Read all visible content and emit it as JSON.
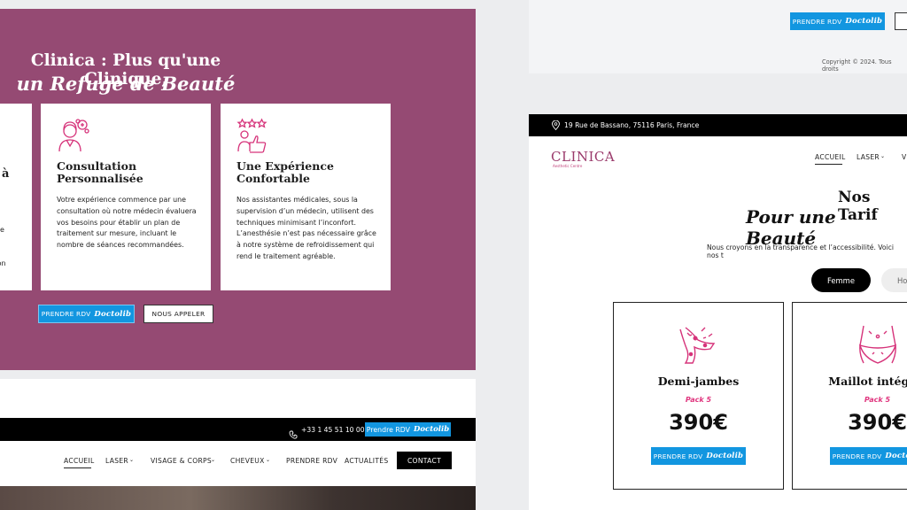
{
  "colors": {
    "purple": "#954a73",
    "blue": "#1296e0",
    "pink": "#e0357e",
    "black": "#000000"
  },
  "hero": {
    "line1": "Clinica : Plus qu'une Clinique,",
    "line2": "un Refuge de Beauté"
  },
  "partial_card": {
    "title_fragment": "à",
    "text_fragments": [
      "e",
      "ision"
    ]
  },
  "cards": [
    {
      "icon": "doctor-consultation-icon",
      "title_line1": "Consultation",
      "title_line2": "Personnalisée",
      "text": "Votre expérience commence par une consultation où notre médecin évaluera vos besoins pour établir un plan de traitement sur mesure, incluant le nombre de séances recommandées."
    },
    {
      "icon": "thumbs-up-stars-icon",
      "title_line1": "Une Expérience",
      "title_line2": "Confortable",
      "text": "Nos assistantes médicales, sous la supervision d’un médecin, utilisent des techniques minimisant l’inconfort. L’anesthésie n’est pas nécessaire grâce à notre système de refroidissement qui rend le traitement agréable."
    }
  ],
  "cta": {
    "rdv_label": "PRENDRE RDV",
    "doctolib": "Doctolib",
    "call_label": "NOUS APPELER"
  },
  "left_header": {
    "phone": "+33 1 45 51 10 00",
    "rdv_label": "Prendre RDV",
    "doctolib": "Doctolib",
    "nav": {
      "accueil": "ACCUEIL",
      "laser": "LASER",
      "visage": "VISAGE & CORPS",
      "cheveux": "CHEVEUX",
      "rdv": "PRENDRE RDV",
      "actualites": "ACTUALITÉS",
      "contact": "CONTACT"
    }
  },
  "right_top": {
    "rdv_label": "PRENDRE RDV",
    "doctolib": "Doctolib",
    "copyright": "Copyright © 2024. Tous droits"
  },
  "right_header": {
    "address": "19 Rue de Bassano, 75116 Paris, France",
    "logo": "CLINICA",
    "logo_sub": "Aesthetic Centre",
    "nav": {
      "accueil": "ACCUEIL",
      "laser": "LASER",
      "partial": "V"
    }
  },
  "tarifs": {
    "title": "Nos Tarif",
    "subtitle": "Pour une Beauté",
    "desc": "Nous croyons en la transparence et l’accessibilité. Voici nos t",
    "tab_active": "Femme",
    "tab_other": "Ho"
  },
  "prices": [
    {
      "icon": "legs-laser-icon",
      "name": "Demi-jambes",
      "pack": "Pack 5",
      "price": "390€",
      "rdv_label": "PRENDRE RDV",
      "doctolib": "Doctolib"
    },
    {
      "icon": "bikini-laser-icon",
      "name": "Maillot intégral",
      "pack": "Pack 5",
      "price": "390€",
      "rdv_label": "PRENDRE RDV",
      "doctolib": "Doctolib"
    }
  ]
}
